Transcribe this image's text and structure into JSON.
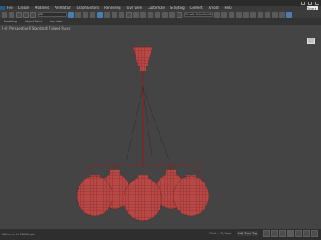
{
  "menu": {
    "items": [
      "File",
      "Create",
      "Modifiers",
      "Animation",
      "Graph Editors",
      "Rendering",
      "Civil View",
      "Customize",
      "Scripting",
      "Content",
      "Arnold",
      "Help"
    ]
  },
  "toolbar": {
    "selection_set_value": "Create Selection Se",
    "search_placeholder": "Type a"
  },
  "ribbon": {
    "tabs": [
      "Modeling",
      "Object Paint",
      "Populate"
    ]
  },
  "viewport": {
    "label": "[+] [Perspective] [Standard] [Edged Faces]"
  },
  "status": {
    "left_text": "Welcome to MAXScript.",
    "grid_text": "Grid = 10,0mm",
    "add_time_tag": "Add Time Tag"
  },
  "colors": {
    "mesh": "#b84845",
    "mesh_dark": "#7a2a28",
    "viewport_bg": "#444444"
  }
}
